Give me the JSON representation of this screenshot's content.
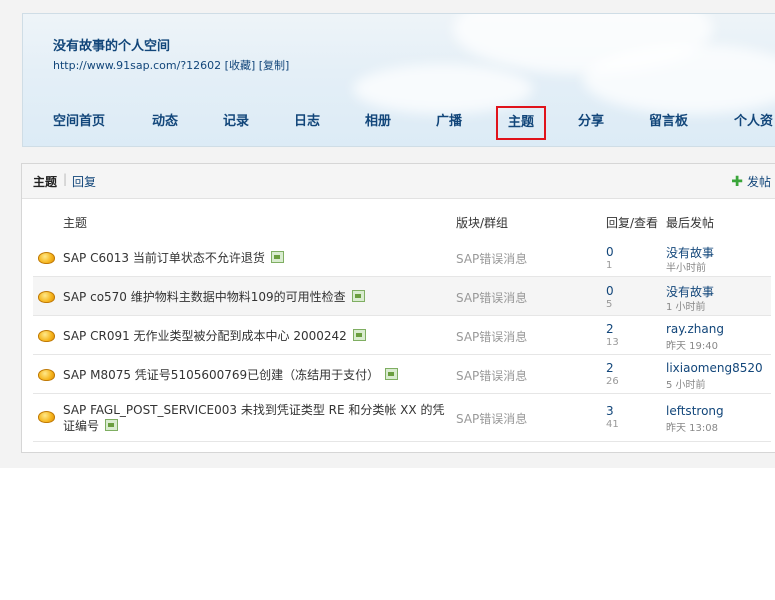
{
  "header": {
    "title": "没有故事的个人空间",
    "url": "http://www.91sap.com/?12602",
    "favorite_label": "[收藏]",
    "copy_label": "[复制]"
  },
  "nav": {
    "items": [
      "空间首页",
      "动态",
      "记录",
      "日志",
      "相册",
      "广播",
      "主题",
      "分享",
      "留言板",
      "个人资"
    ],
    "active": "主题"
  },
  "tabs": {
    "topics": "主题",
    "separator": "|",
    "replies": "回复",
    "post_button": "发帖"
  },
  "table": {
    "headers": {
      "topic": "主题",
      "forum": "版块/群组",
      "reply_view": "回复/查看",
      "last_post": "最后发帖"
    },
    "rows": [
      {
        "title": "SAP C6013 当前订单状态不允许退货",
        "forum": "SAP错误消息",
        "replies": "0",
        "views": "1",
        "last_user": "没有故事",
        "last_time": "半小时前"
      },
      {
        "title": "SAP co570 维护物料主数据中物料109的可用性检查",
        "forum": "SAP错误消息",
        "replies": "0",
        "views": "5",
        "last_user": "没有故事",
        "last_time": "1 小时前"
      },
      {
        "title": "SAP CR091 无作业类型被分配到成本中心 2000242",
        "forum": "SAP错误消息",
        "replies": "2",
        "views": "13",
        "last_user": "ray.zhang",
        "last_time": "昨天 19:40"
      },
      {
        "title": "SAP M8075 凭证号5105600769已创建（冻结用于支付）",
        "forum": "SAP错误消息",
        "replies": "2",
        "views": "26",
        "last_user": "lixiaomeng8520",
        "last_time": "5 小时前"
      },
      {
        "title": "SAP FAGL_POST_SERVICE003 未找到凭证类型 RE 和分类帐 XX 的凭证编号",
        "forum": "SAP错误消息",
        "replies": "3",
        "views": "41",
        "last_user": "leftstrong",
        "last_time": "昨天 13:08"
      }
    ]
  },
  "icons": {
    "row_icon": "gold-ingot-icon",
    "attachment_icon": "image-attachment-icon",
    "post_icon": "plus-icon"
  },
  "colors": {
    "link": "#12467a",
    "active_outline": "#e0131b",
    "muted": "#999999"
  }
}
